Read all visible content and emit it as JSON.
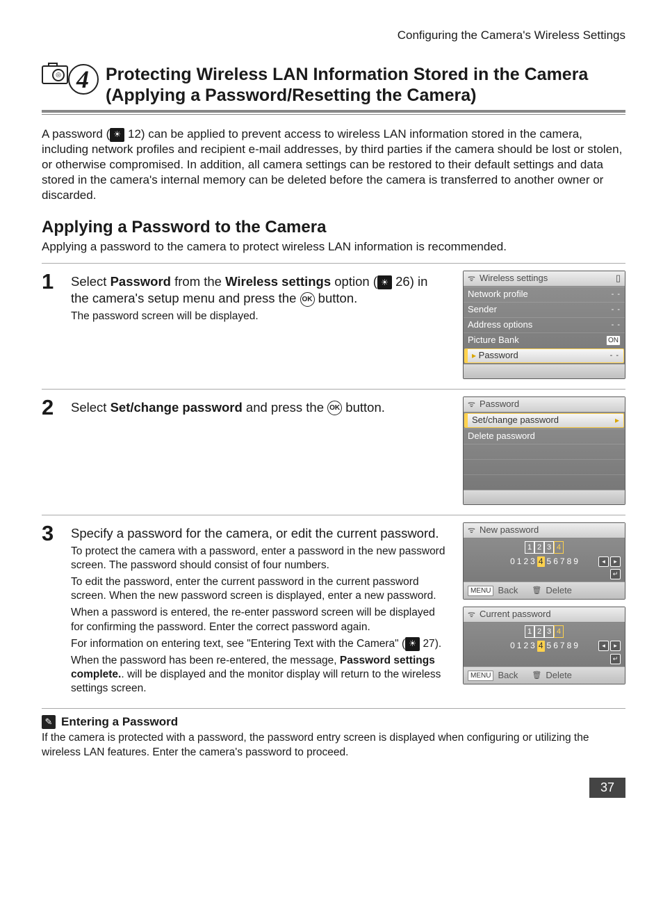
{
  "running_head": "Configuring the Camera's Wireless Settings",
  "section": {
    "number": "4",
    "title_l1": "Protecting Wireless LAN Information Stored in the Camera",
    "title_l2": "(Applying a Password/Resetting the Camera)",
    "icon": "camera-icon"
  },
  "intro": {
    "prefix": "A password (",
    "ref1": "12",
    "rest": ") can be applied to prevent access to wireless LAN information stored in the camera, including network profiles and recipient e-mail addresses, by third parties if the camera should be lost or stolen, or otherwise compromised. In addition, all camera settings can be restored to their default settings and data stored in the camera's internal memory can be deleted before the camera is transferred to another owner or discarded."
  },
  "subheading": "Applying a Password to the Camera",
  "subdesc": "Applying a password to the camera to protect wireless LAN information is recommended.",
  "steps": {
    "s1": {
      "num": "1",
      "a": "Select ",
      "b": "Password",
      "c": " from the ",
      "d": "Wireless settings",
      "e": " option (",
      "ref": "26",
      "f": ") in the camera's setup menu and press the ",
      "ok": "OK",
      "g": " button.",
      "sub": "The password screen will be displayed."
    },
    "s2": {
      "num": "2",
      "a": "Select ",
      "b": "Set/change password",
      "c": " and press the ",
      "ok": "OK",
      "d": " button."
    },
    "s3": {
      "num": "3",
      "lead": "Specify a password for the camera, or edit the current password.",
      "p1": "To protect the camera with a password, enter a password in the new password screen. The password should consist of four numbers.",
      "p2": "To edit the password, enter the current password in the current password screen. When the new password screen is displayed, enter a new password.",
      "p3": "When a password is entered, the re-enter password screen will be displayed for confirming the password. Enter the correct password again.",
      "p4a": "For information on entering text, see \"Entering Text with the Camera\" (",
      "p4ref": "27",
      "p4b": ").",
      "p5a": "When the password has been re-entered, the message, ",
      "p5b": "Password settings complete.",
      "p5c": ". will be displayed and the monitor display will return to the wireless settings screen."
    }
  },
  "screens": {
    "ws": {
      "title": "Wireless settings",
      "items": [
        {
          "label": "Network profile",
          "val": "- -"
        },
        {
          "label": "Sender",
          "val": "- -"
        },
        {
          "label": "Address options",
          "val": "- -"
        },
        {
          "label": "Picture Bank",
          "val": "ON"
        }
      ],
      "selected": "Password",
      "selected_val": "- -"
    },
    "pw": {
      "title": "Password",
      "selected": "Set/change password",
      "other": "Delete password"
    },
    "newpw": {
      "title": "New password",
      "digits": [
        "1",
        "2",
        "3",
        "4"
      ],
      "row": [
        "0",
        "1",
        "2",
        "3",
        "4",
        "5",
        "6",
        "7",
        "8",
        "9"
      ],
      "hl_index": 4,
      "back": "Back",
      "delete": "Delete",
      "menu": "MENU"
    },
    "curpw": {
      "title": "Current password",
      "digits": [
        "1",
        "2",
        "3",
        "4"
      ],
      "row": [
        "0",
        "1",
        "2",
        "3",
        "4",
        "5",
        "6",
        "7",
        "8",
        "9"
      ],
      "hl_index": 4,
      "back": "Back",
      "delete": "Delete",
      "menu": "MENU"
    }
  },
  "note": {
    "title": "Entering a Password",
    "body": "If the camera is protected with a password, the password entry screen is displayed when configuring or utilizing the wireless LAN features. Enter the camera's password to proceed."
  },
  "page_number": "37",
  "chart_data": null
}
